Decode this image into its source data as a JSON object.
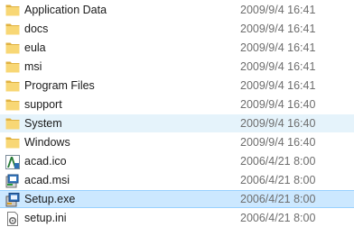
{
  "colors": {
    "folder": "#f8d775",
    "folder_dark": "#e0b241",
    "hover_bg": "#e5f3fb",
    "selected_bg": "#cce8ff",
    "selected_border": "#99d1ff",
    "date_text": "#6d6d6d"
  },
  "files": [
    {
      "name": "Application Data",
      "date": "2009/9/4 16:41",
      "icon": "folder-icon",
      "state": "normal"
    },
    {
      "name": "docs",
      "date": "2009/9/4 16:41",
      "icon": "folder-icon",
      "state": "normal"
    },
    {
      "name": "eula",
      "date": "2009/9/4 16:41",
      "icon": "folder-icon",
      "state": "normal"
    },
    {
      "name": "msi",
      "date": "2009/9/4 16:41",
      "icon": "folder-icon",
      "state": "normal"
    },
    {
      "name": "Program Files",
      "date": "2009/9/4 16:41",
      "icon": "folder-icon",
      "state": "normal"
    },
    {
      "name": "support",
      "date": "2009/9/4 16:40",
      "icon": "folder-icon",
      "state": "normal"
    },
    {
      "name": "System",
      "date": "2009/9/4 16:40",
      "icon": "folder-icon",
      "state": "hover"
    },
    {
      "name": "Windows",
      "date": "2009/9/4 16:40",
      "icon": "folder-icon",
      "state": "normal"
    },
    {
      "name": "acad.ico",
      "date": "2006/4/21 8:00",
      "icon": "autocad-icon",
      "state": "normal"
    },
    {
      "name": "acad.msi",
      "date": "2006/4/21 8:00",
      "icon": "installer-package-icon",
      "state": "normal"
    },
    {
      "name": "Setup.exe",
      "date": "2006/4/21 8:00",
      "icon": "setup-application-icon",
      "state": "selected"
    },
    {
      "name": "setup.ini",
      "date": "2006/4/21 8:00",
      "icon": "settings-file-icon",
      "state": "normal"
    }
  ]
}
